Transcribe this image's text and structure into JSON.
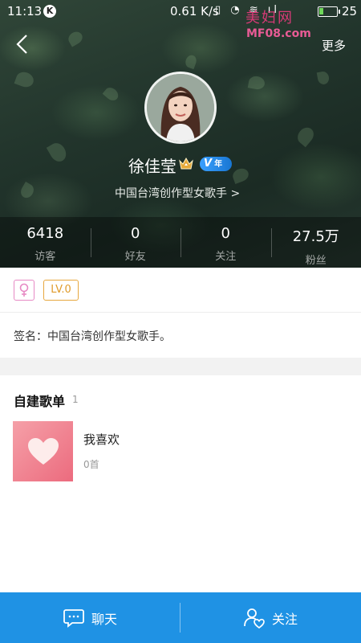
{
  "status_bar": {
    "time": "11:13",
    "app_badge": "K",
    "network_speed": "0.61 K/s",
    "battery_level": "25",
    "battery_fraction": 0.25
  },
  "watermark": {
    "title": "美妇网",
    "url": "MF08.com"
  },
  "nav": {
    "more_label": "更多"
  },
  "profile": {
    "name": "徐佳莹",
    "vip_badge_text": "年",
    "subtitle": "中国台湾创作型女歌手",
    "subtitle_arrow": ">"
  },
  "stats": [
    {
      "value": "6418",
      "label": "访客"
    },
    {
      "value": "0",
      "label": "好友"
    },
    {
      "value": "0",
      "label": "关注"
    },
    {
      "value": "27.5万",
      "label": "粉丝"
    }
  ],
  "badges": {
    "level": "LV.0"
  },
  "signature": {
    "text": "签名：中国台湾创作型女歌手。"
  },
  "playlists": {
    "title": "自建歌单",
    "count": "1",
    "items": [
      {
        "name": "我喜欢",
        "tracks": "0首"
      }
    ]
  },
  "bottom_bar": {
    "chat_label": "聊天",
    "follow_label": "关注"
  },
  "colors": {
    "accent": "#1f92e4",
    "level_badge": "#e7a73f",
    "gender_badge": "#e78ac4",
    "cover_gradient_start": "#f5a0a8",
    "cover_gradient_end": "#ec6b7e"
  },
  "icons": {
    "back": "chevron-left-icon",
    "crown": "crown-icon",
    "vip": "vip-icon",
    "gender": "female-icon",
    "heart": "heart-icon",
    "chat": "chat-bubble-icon",
    "follow": "user-heart-icon"
  }
}
